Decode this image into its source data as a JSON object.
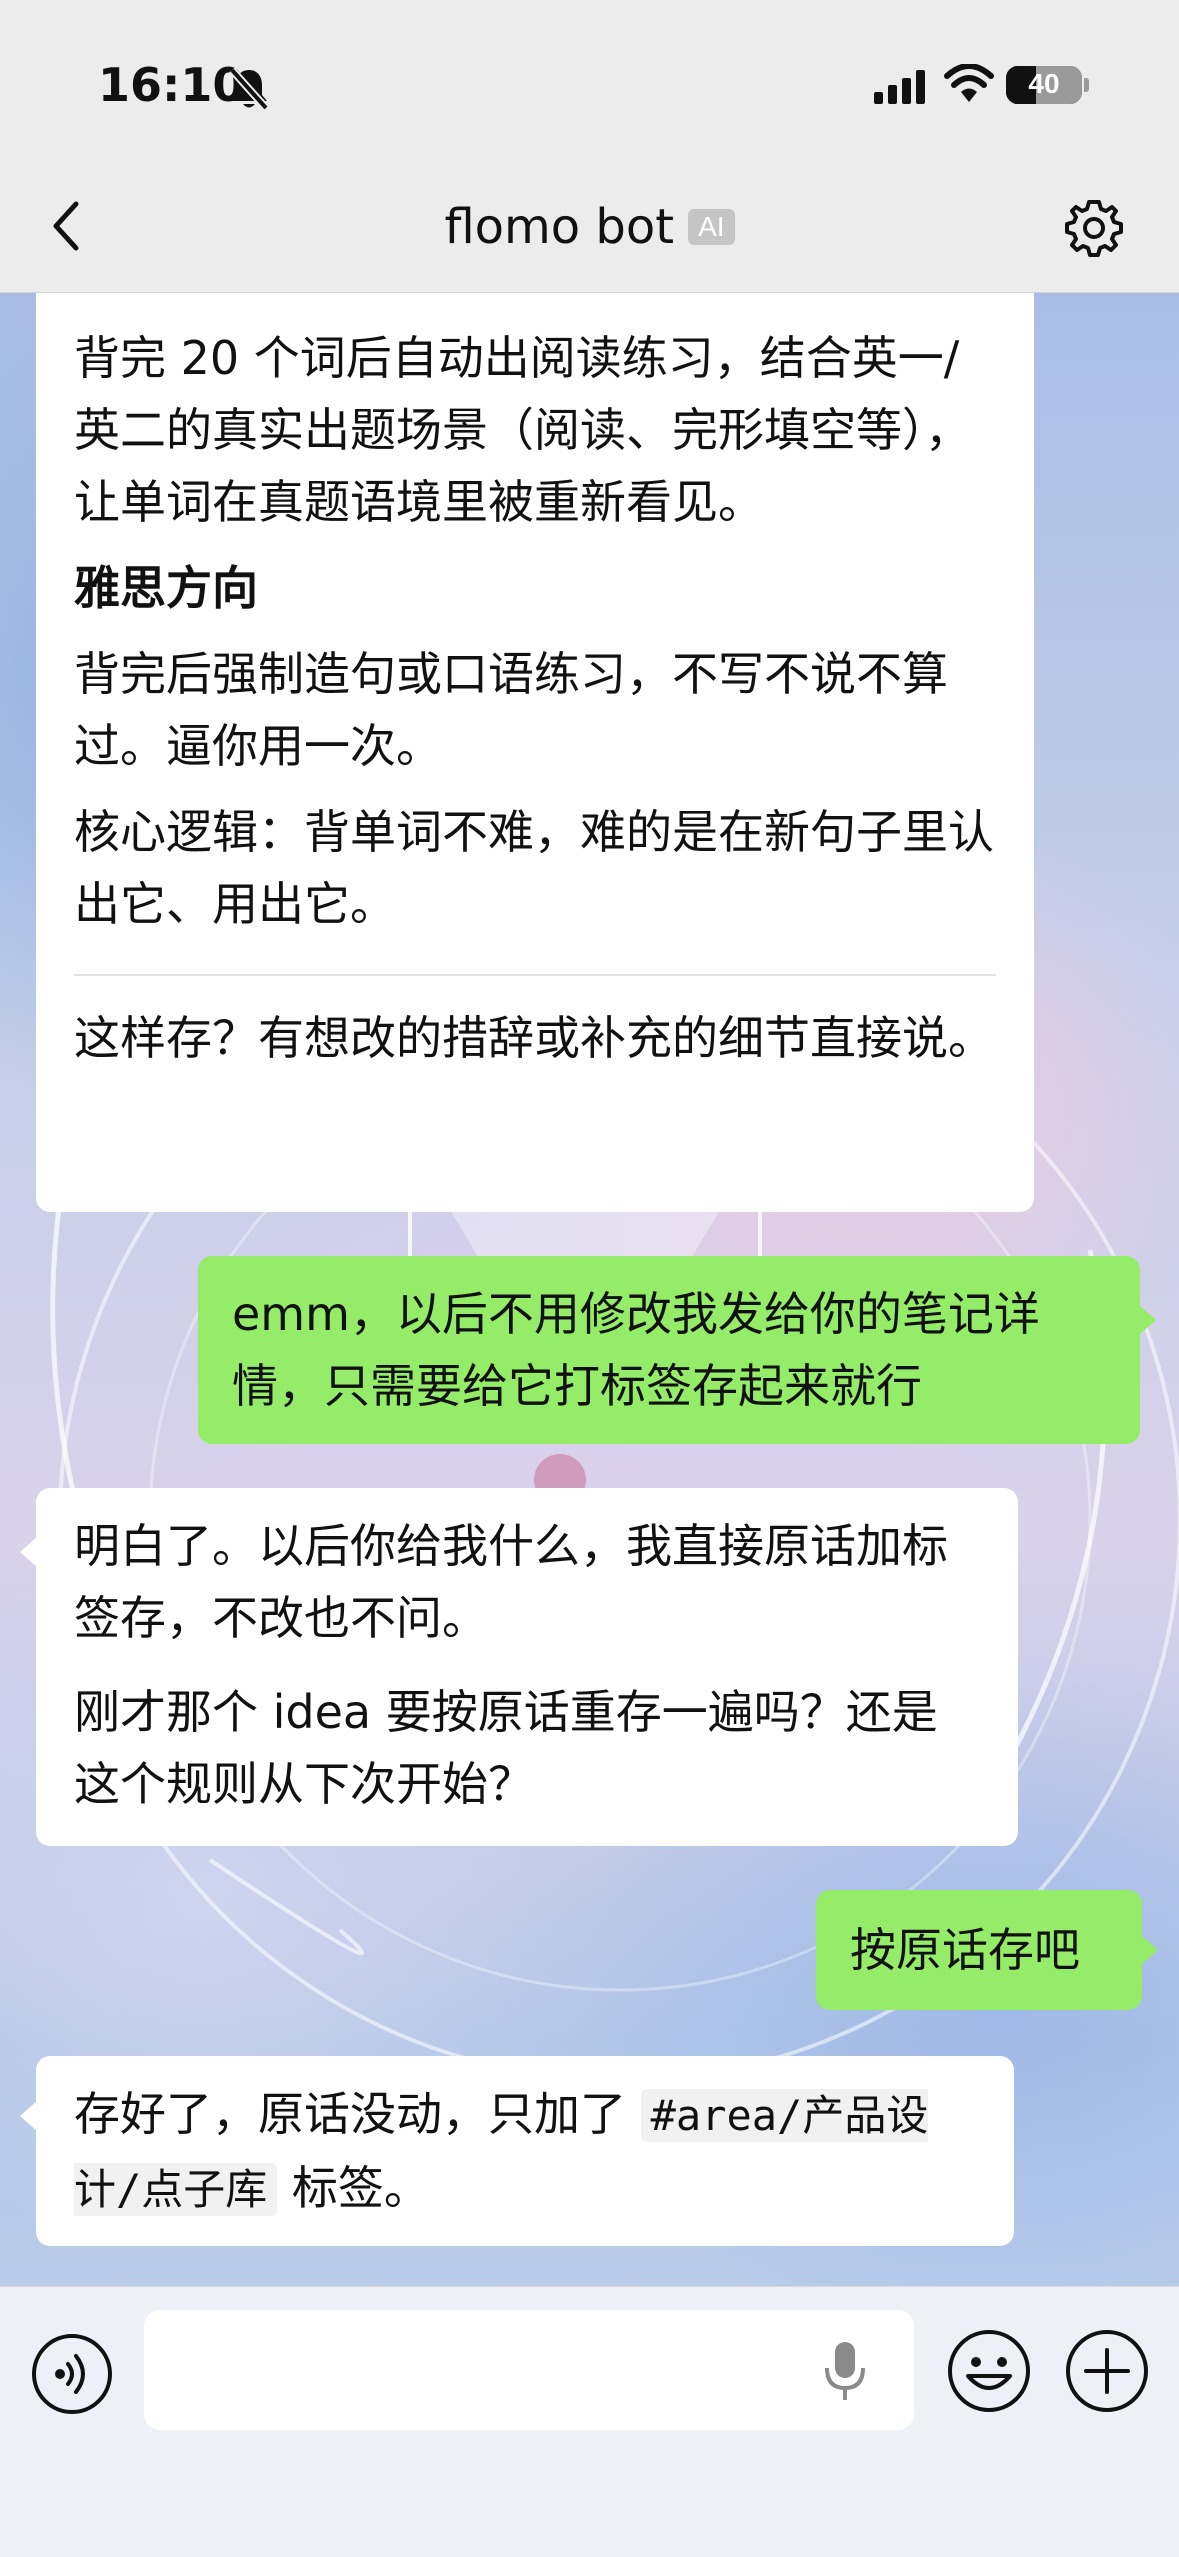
{
  "status_bar": {
    "time": "16:10",
    "battery": "40"
  },
  "nav": {
    "title": "flomo bot",
    "badge": "AI"
  },
  "messages": {
    "m1": {
      "p1": "背完 20 个词后自动出阅读练习，结合英一/英二的真实出题场景（阅读、完形填空等），让单词在真题语境里被重新看见。",
      "heading": "雅思方向",
      "p2": "背完后强制造句或口语练习，不写不说不算过。逼你用一次。",
      "p3": "核心逻辑：背单词不难，难的是在新句子里认出它、用出它。",
      "p4": "这样存？有想改的措辞或补充的细节直接说。"
    },
    "m2": {
      "text": "emm，以后不用修改我发给你的笔记详情，只需要给它打标签存起来就行"
    },
    "m3": {
      "p1": "明白了。以后你给我什么，我直接原话加标签存，不改也不问。",
      "p2": "刚才那个 idea 要按原话重存一遍吗？还是这个规则从下次开始？"
    },
    "m4": {
      "text": "按原话存吧"
    },
    "m5": {
      "pre": "存好了，原话没动，只加了 ",
      "tag": "#area/产品设计/点子库",
      "post": " 标签。"
    }
  },
  "icons": {
    "back": "chevron-left-icon",
    "settings": "gear-icon",
    "mute": "bell-slash-icon",
    "voice": "voice-icon",
    "mic": "mic-icon",
    "emoji": "emoji-icon",
    "plus": "plus-icon"
  },
  "colors": {
    "user_bubble": "#95ec69",
    "bot_bubble": "#ffffff",
    "nav_bg": "#ececec"
  }
}
